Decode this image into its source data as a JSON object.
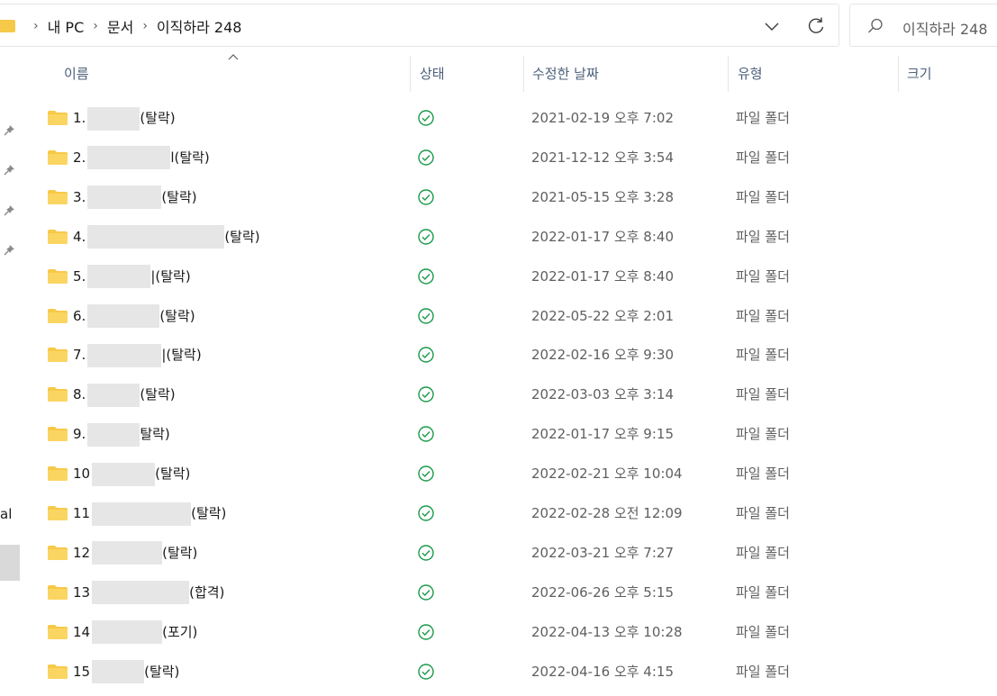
{
  "address": {
    "crumbs": [
      "내 PC",
      "문서",
      "이직하라 248"
    ],
    "separator": "›"
  },
  "search": {
    "placeholder": "이직하라 248"
  },
  "nav": {
    "partial_label": "al"
  },
  "columns": {
    "name": "이름",
    "status": "상태",
    "modified": "수정한 날짜",
    "type": "유형",
    "size": "크기"
  },
  "colors": {
    "folder": "#f7c948",
    "status_ok": "#1c9a4a",
    "header_text": "#4c607a"
  },
  "rows": [
    {
      "num": "1.",
      "suffix": "(탈락)",
      "date": "2021-02-19 오후 7:02",
      "type": "파일 폴더",
      "status": "synced"
    },
    {
      "num": "2.",
      "suffix": "l(탈락)",
      "date": "2021-12-12 오후 3:54",
      "type": "파일 폴더",
      "status": "synced"
    },
    {
      "num": "3.",
      "suffix": "(탈락)",
      "date": "2021-05-15 오후 3:28",
      "type": "파일 폴더",
      "status": "synced"
    },
    {
      "num": "4.",
      "suffix": "(탈락)",
      "date": "2022-01-17 오후 8:40",
      "type": "파일 폴더",
      "status": "synced"
    },
    {
      "num": "5.",
      "suffix": "|(탈락)",
      "date": "2022-01-17 오후 8:40",
      "type": "파일 폴더",
      "status": "synced"
    },
    {
      "num": "6.",
      "suffix": "(탈락)",
      "date": "2022-05-22 오후 2:01",
      "type": "파일 폴더",
      "status": "synced"
    },
    {
      "num": "7.",
      "suffix": "|(탈락)",
      "date": "2022-02-16 오후 9:30",
      "type": "파일 폴더",
      "status": "synced"
    },
    {
      "num": "8.",
      "suffix": "(탈락)",
      "date": "2022-03-03 오후 3:14",
      "type": "파일 폴더",
      "status": "synced"
    },
    {
      "num": "9.",
      "suffix": "탈락)",
      "date": "2022-01-17 오후 9:15",
      "type": "파일 폴더",
      "status": "synced"
    },
    {
      "num": "10",
      "suffix": "(탈락)",
      "date": "2022-02-21 오후 10:04",
      "type": "파일 폴더",
      "status": "synced"
    },
    {
      "num": "11",
      "suffix": "(탈락)",
      "date": "2022-02-28 오전 12:09",
      "type": "파일 폴더",
      "status": "synced"
    },
    {
      "num": "12",
      "suffix": "(탈락)",
      "date": "2022-03-21 오후 7:27",
      "type": "파일 폴더",
      "status": "synced"
    },
    {
      "num": "13",
      "suffix": "(합격)",
      "date": "2022-06-26 오후 5:15",
      "type": "파일 폴더",
      "status": "synced"
    },
    {
      "num": "14",
      "suffix": "(포기)",
      "date": "2022-04-13 오후 10:28",
      "type": "파일 폴더",
      "status": "synced"
    },
    {
      "num": "15",
      "suffix": "(탈락)",
      "date": "2022-04-16 오후 4:15",
      "type": "파일 폴더",
      "status": "synced"
    }
  ]
}
